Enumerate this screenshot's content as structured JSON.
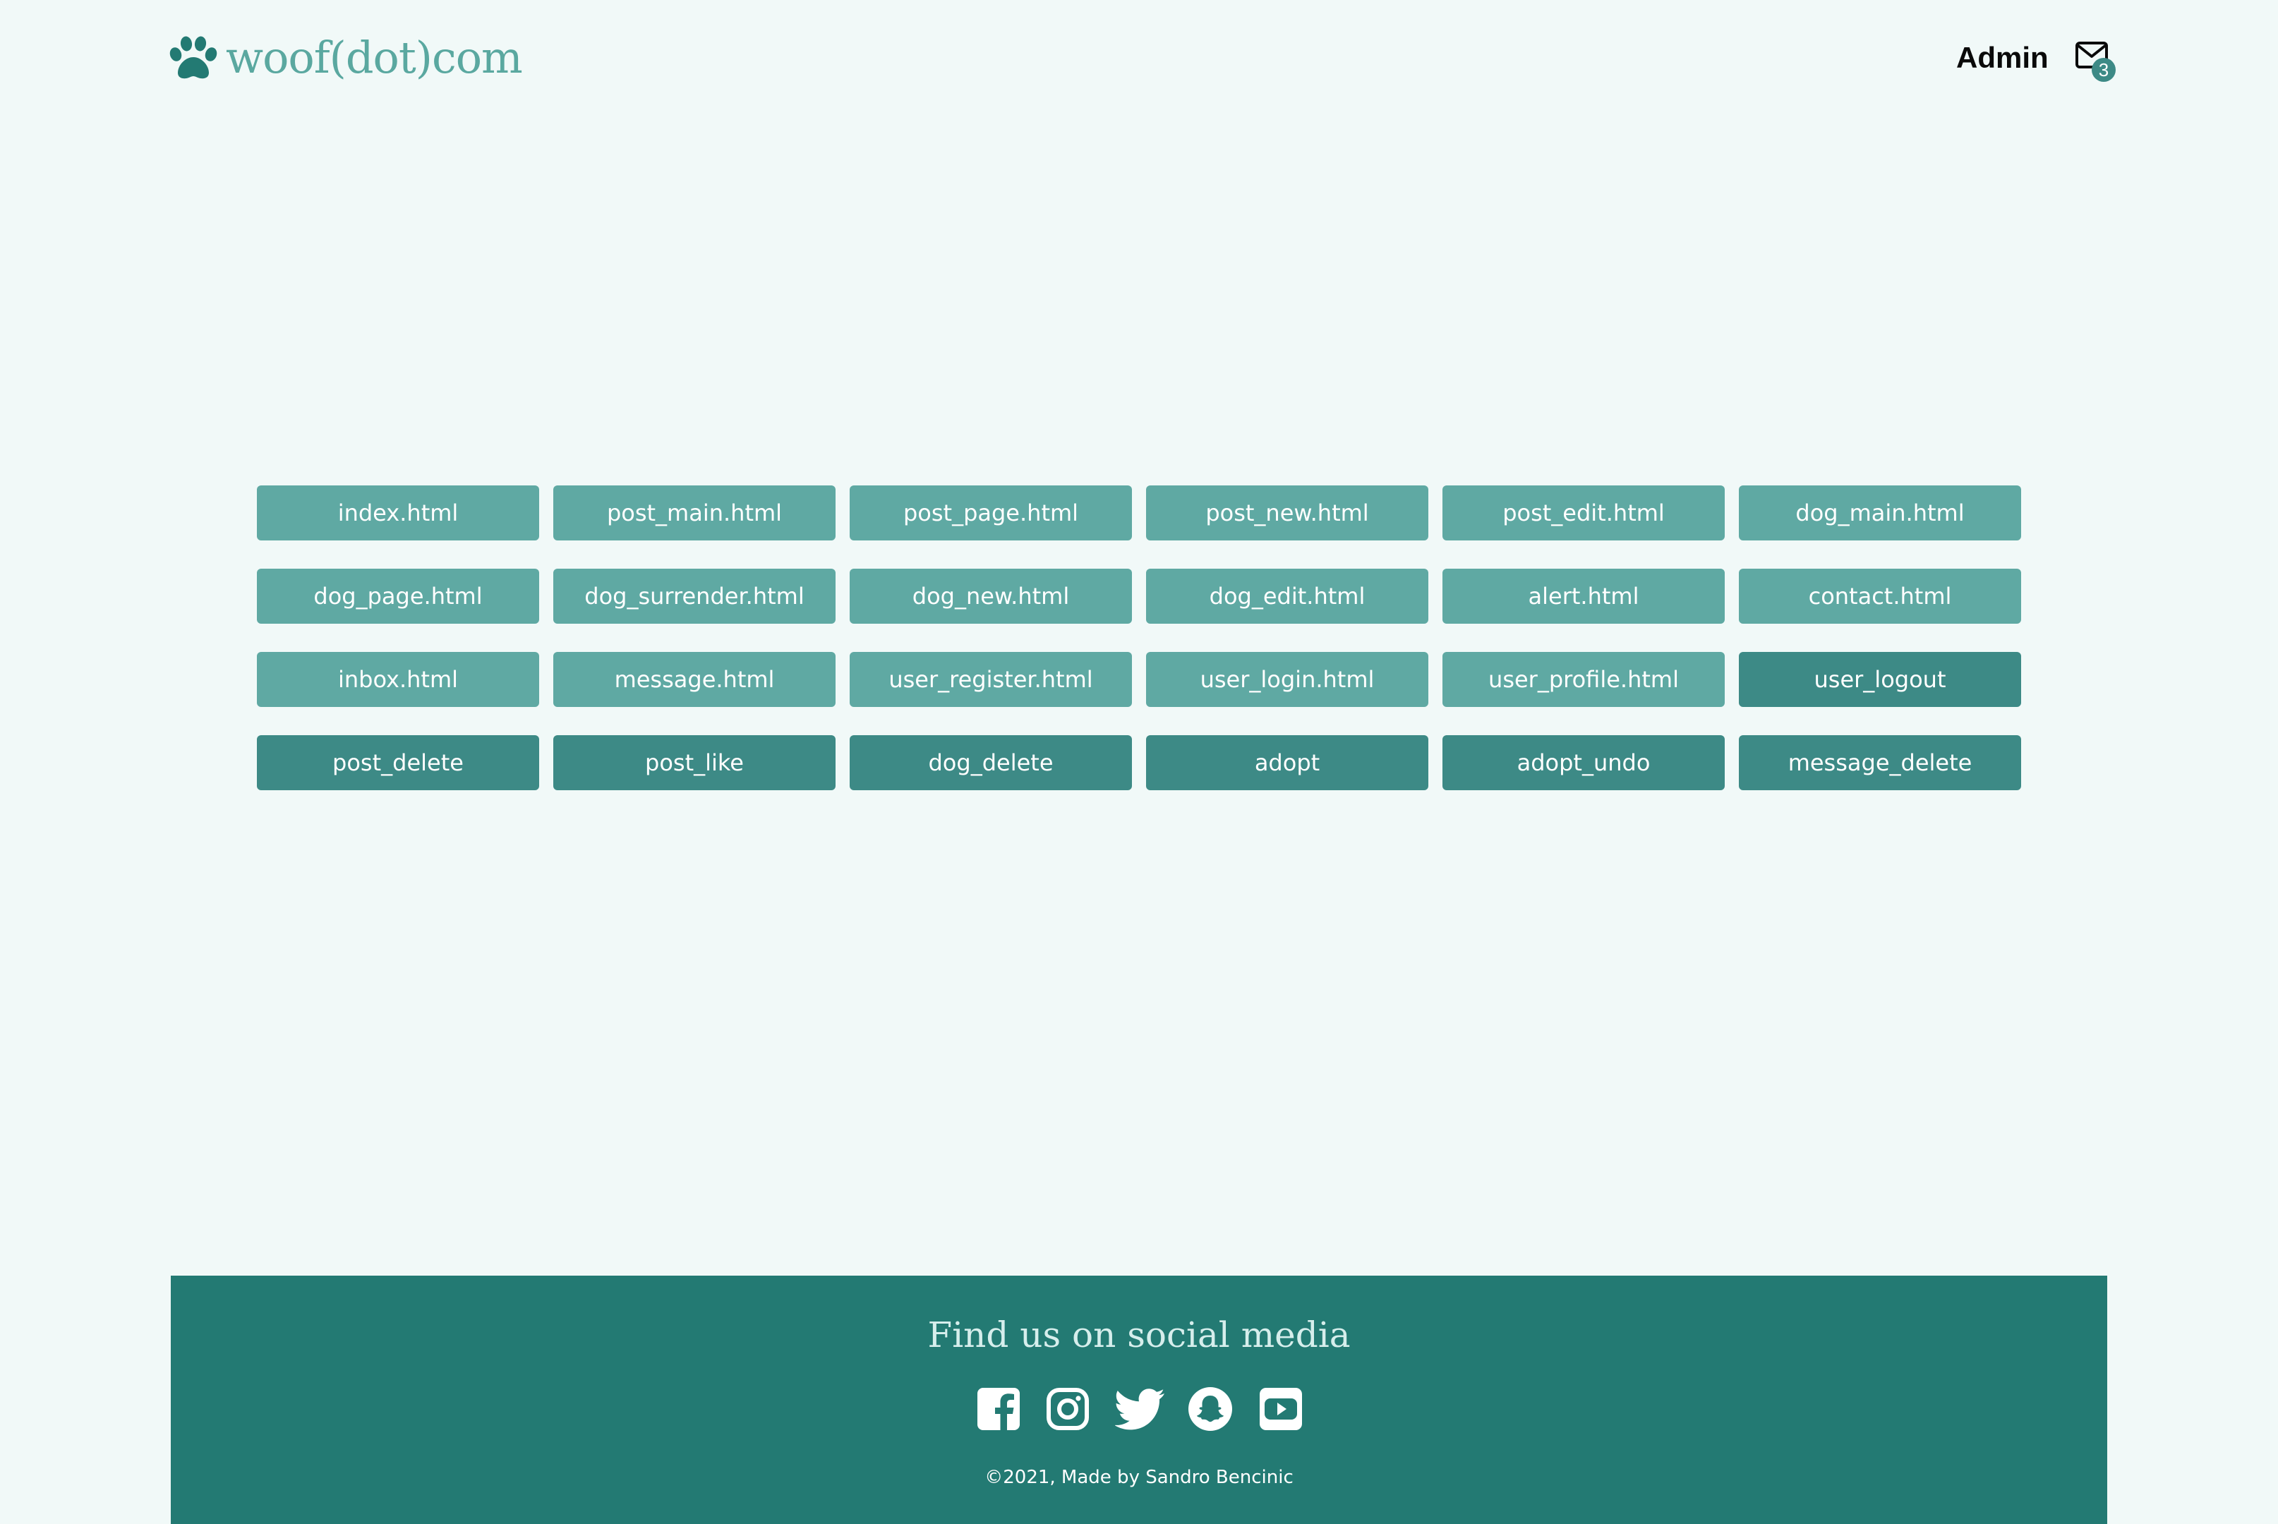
{
  "header": {
    "logo_text": "woof(dot)com",
    "logo_icon": "paw-icon",
    "admin_label": "Admin",
    "inbox_icon": "envelope-icon",
    "inbox_badge_count": "3"
  },
  "buttons": [
    {
      "label": "index.html",
      "style": "light"
    },
    {
      "label": "post_main.html",
      "style": "light"
    },
    {
      "label": "post_page.html",
      "style": "light"
    },
    {
      "label": "post_new.html",
      "style": "light"
    },
    {
      "label": "post_edit.html",
      "style": "light"
    },
    {
      "label": "dog_main.html",
      "style": "light"
    },
    {
      "label": "dog_page.html",
      "style": "light"
    },
    {
      "label": "dog_surrender.html",
      "style": "light"
    },
    {
      "label": "dog_new.html",
      "style": "light"
    },
    {
      "label": "dog_edit.html",
      "style": "light"
    },
    {
      "label": "alert.html",
      "style": "light"
    },
    {
      "label": "contact.html",
      "style": "light"
    },
    {
      "label": "inbox.html",
      "style": "light"
    },
    {
      "label": "message.html",
      "style": "light"
    },
    {
      "label": "user_register.html",
      "style": "light"
    },
    {
      "label": "user_login.html",
      "style": "light"
    },
    {
      "label": "user_profile.html",
      "style": "light"
    },
    {
      "label": "user_logout",
      "style": "dark"
    },
    {
      "label": "post_delete",
      "style": "dark"
    },
    {
      "label": "post_like",
      "style": "dark"
    },
    {
      "label": "dog_delete",
      "style": "dark"
    },
    {
      "label": "adopt",
      "style": "dark"
    },
    {
      "label": "adopt_undo",
      "style": "dark"
    },
    {
      "label": "message_delete",
      "style": "dark"
    }
  ],
  "footer": {
    "heading": "Find us on social media",
    "social_icons": [
      "facebook-icon",
      "instagram-icon",
      "twitter-icon",
      "snapchat-icon",
      "youtube-icon"
    ],
    "copyright": "©2021, Made by Sandro Bencinic"
  },
  "colors": {
    "page_background": "#f1f9f8",
    "brand_teal": "#237a73",
    "logo_text": "#5aa8a0",
    "button_light": "#5fa9a3",
    "button_dark": "#3d8a86",
    "footer_heading": "#d6eeec"
  }
}
